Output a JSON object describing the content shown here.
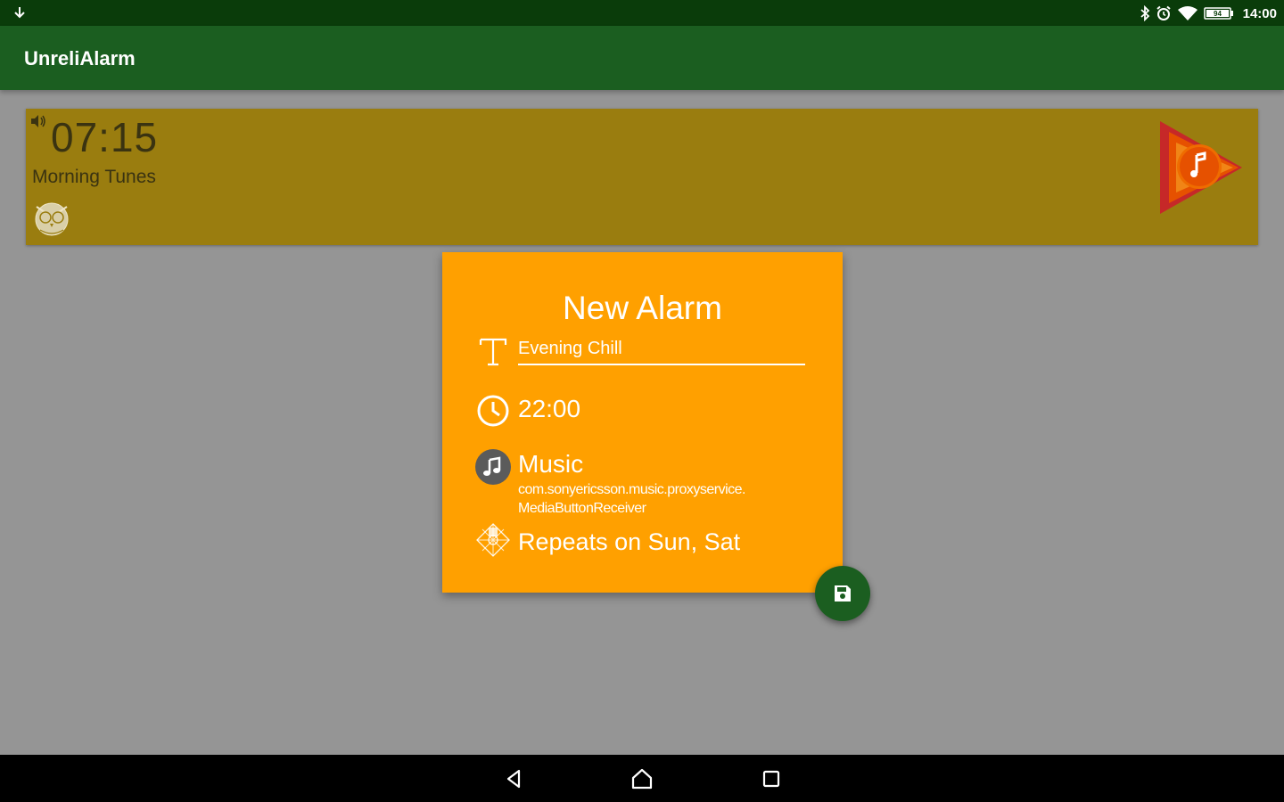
{
  "status_bar": {
    "time": "14:00",
    "battery": "94",
    "icons": [
      "download-icon",
      "bluetooth-icon",
      "alarm-clock-icon",
      "wifi-icon",
      "battery-icon"
    ]
  },
  "app_bar": {
    "title": "UnreliAlarm"
  },
  "alarm_list": [
    {
      "time": "07:15",
      "name": "Morning Tunes",
      "icons": [
        "speaker-icon",
        "owl-icon",
        "play-music-icon"
      ]
    }
  ],
  "dialog": {
    "title": "New Alarm",
    "name_field_value": "Evening Chill",
    "time": "22:00",
    "sound_type": "Music",
    "sound_source": "com.sonyericsson.music.proxyservice.\nMediaButtonReceiver",
    "repeat": "Repeats on Sun, Sat",
    "icons": [
      "text-icon",
      "clock-icon",
      "music-note-icon",
      "repeat-pattern-icon"
    ]
  },
  "fab": {
    "icon": "save-icon"
  },
  "nav_bar": {
    "buttons": [
      "back-icon",
      "home-icon",
      "recents-icon"
    ]
  },
  "colors": {
    "status_bar": "#0a3c0a",
    "app_bar": "#1b5e20",
    "background": "#959595",
    "alarm_card": "#9a7d0f",
    "dialog": "#ffa000",
    "fab": "#1b5e20",
    "nav_bar": "#000000"
  }
}
